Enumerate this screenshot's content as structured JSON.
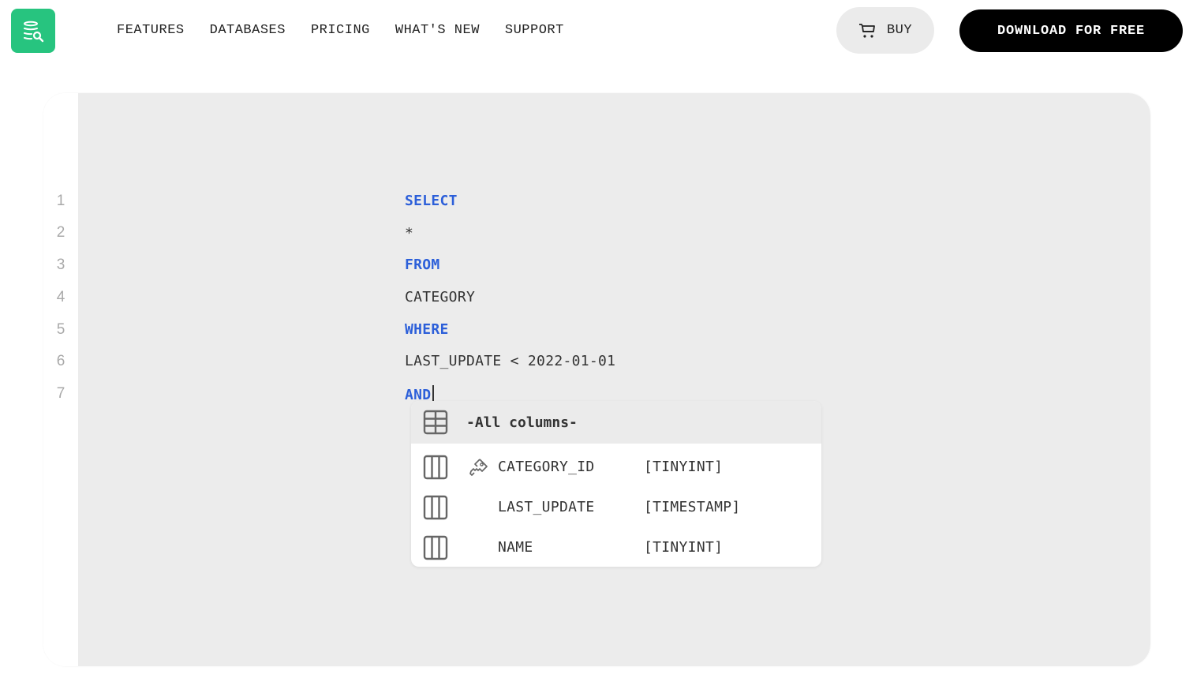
{
  "header": {
    "logo_icon": "database-search-icon",
    "brand_color": "#27c47f",
    "nav": [
      {
        "label": "FEATURES"
      },
      {
        "label": "DATABASES"
      },
      {
        "label": "PRICING"
      },
      {
        "label": "WHAT'S NEW"
      },
      {
        "label": "SUPPORT"
      }
    ],
    "buy_label": "BUY",
    "buy_icon": "cart-icon",
    "download_label": "DOWNLOAD FOR FREE"
  },
  "editor": {
    "keyword_color": "#2c5fd9",
    "lines": [
      {
        "num": "1",
        "text": "SELECT",
        "keyword": true
      },
      {
        "num": "2",
        "text": "*",
        "keyword": false
      },
      {
        "num": "3",
        "text": "FROM",
        "keyword": true
      },
      {
        "num": "4",
        "text": "CATEGORY",
        "keyword": false
      },
      {
        "num": "5",
        "text": "WHERE",
        "keyword": true
      },
      {
        "num": "6",
        "text": "LAST_UPDATE < 2022-01-01",
        "keyword": false
      },
      {
        "num": "7",
        "text": "AND",
        "keyword": true
      }
    ]
  },
  "autocomplete": {
    "header_label": "-All columns-",
    "header_icon": "table-icon",
    "items": [
      {
        "name": "CATEGORY_ID",
        "type": "[TINYINT]",
        "primary_key": true,
        "icon": "column-icon"
      },
      {
        "name": "LAST_UPDATE",
        "type": "[TIMESTAMP]",
        "primary_key": false,
        "icon": "column-icon"
      },
      {
        "name": "NAME",
        "type": "[TINYINT]",
        "primary_key": false,
        "icon": "column-icon"
      }
    ]
  }
}
